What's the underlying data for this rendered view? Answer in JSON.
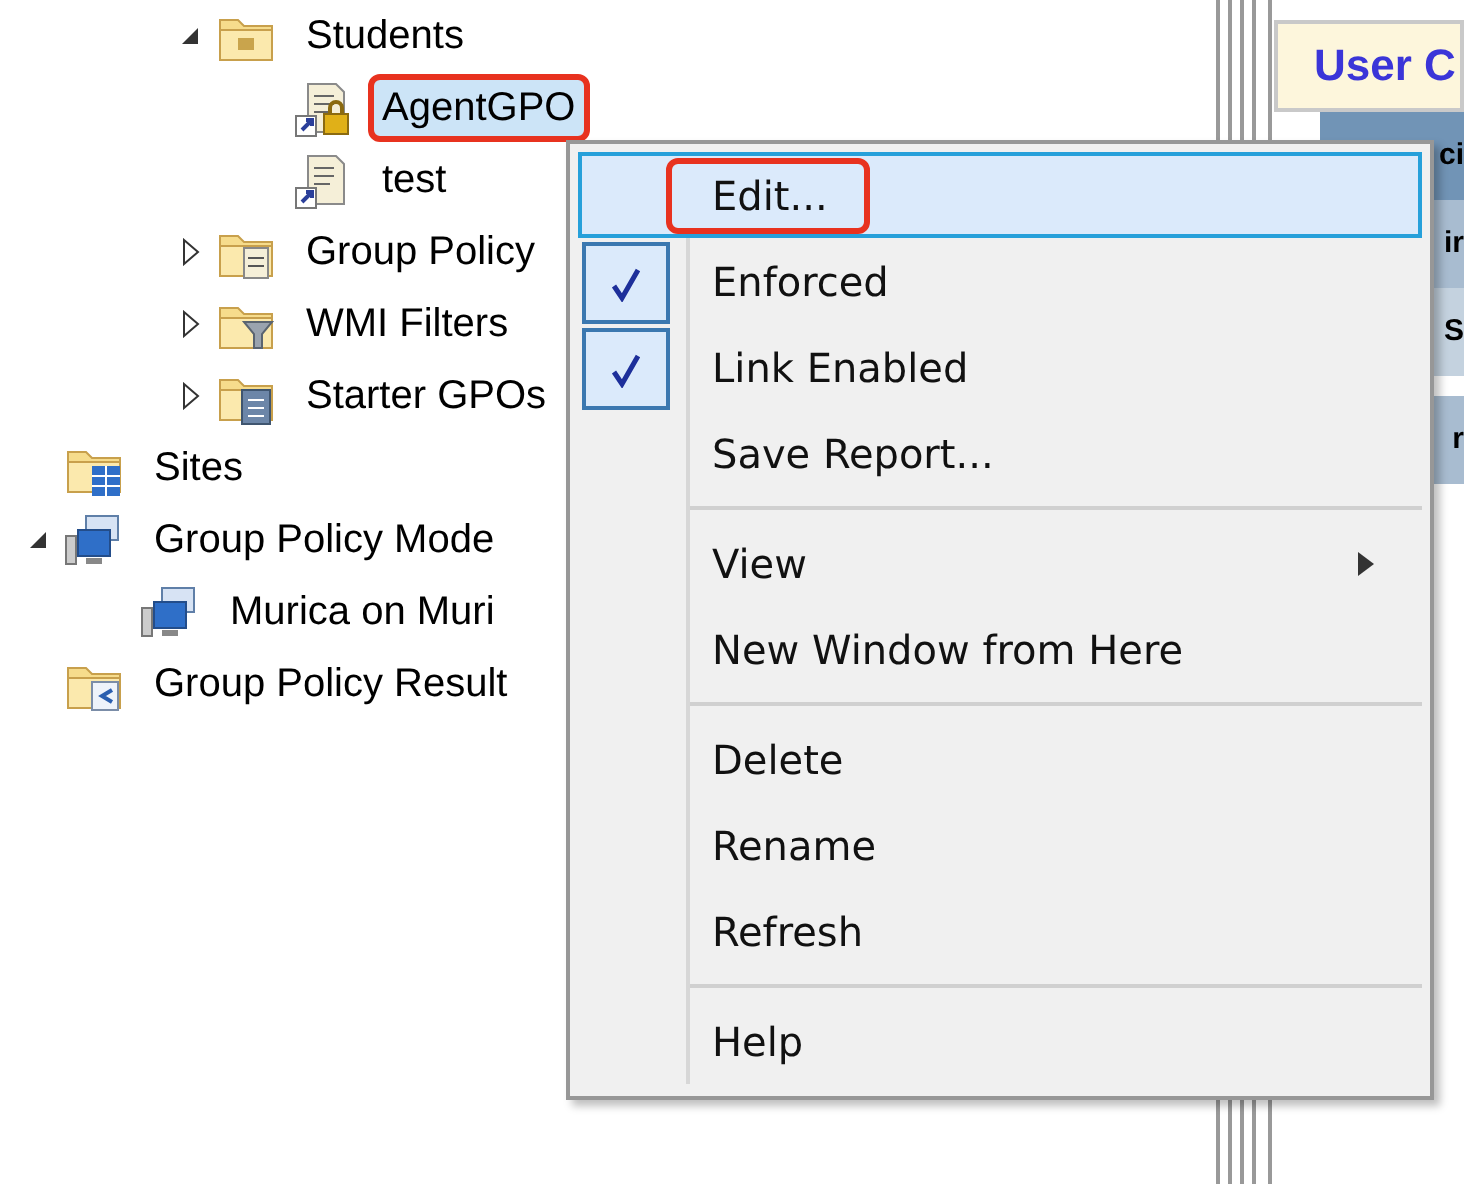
{
  "tree": {
    "branch": [
      {
        "label": "Students",
        "kind": "folder",
        "expanded": true,
        "selected": false,
        "callout": false,
        "children": [
          {
            "label": "AgentGPO",
            "kind": "gpo-locked",
            "selected": true,
            "callout": true
          },
          {
            "label": "test",
            "kind": "gpo",
            "selected": false,
            "callout": false
          }
        ]
      },
      {
        "label": "Group Policy",
        "kind": "gpo-folder",
        "expanded": false,
        "selected": false,
        "callout": false
      },
      {
        "label": "WMI Filters",
        "kind": "filters",
        "expanded": false,
        "selected": false,
        "callout": false
      },
      {
        "label": "Starter GPOs",
        "kind": "starter",
        "expanded": false,
        "selected": false,
        "callout": false
      }
    ],
    "roots": [
      {
        "label": "Sites",
        "kind": "sites",
        "selected": false,
        "callout": false
      },
      {
        "label": "Group Policy Mode",
        "kind": "modeling",
        "expanded": true,
        "selected": false,
        "callout": false,
        "children": [
          {
            "label": "Murica on Muri",
            "kind": "computer",
            "selected": false,
            "callout": false
          }
        ]
      },
      {
        "label": "Group Policy Result",
        "kind": "results",
        "selected": false,
        "callout": false
      }
    ]
  },
  "details": {
    "header": "User C",
    "rows": [
      "ci",
      "ir",
      "S",
      "r"
    ]
  },
  "context_menu": {
    "groups": [
      [
        {
          "label": "Edit...",
          "selected": true,
          "checked": false,
          "submenu": false,
          "callout": true
        },
        {
          "label": "Enforced",
          "selected": false,
          "checked": true,
          "submenu": false,
          "callout": false
        },
        {
          "label": "Link Enabled",
          "selected": false,
          "checked": true,
          "submenu": false,
          "callout": false
        },
        {
          "label": "Save Report...",
          "selected": false,
          "checked": false,
          "submenu": false,
          "callout": false
        }
      ],
      [
        {
          "label": "View",
          "selected": false,
          "checked": false,
          "submenu": true,
          "callout": false
        },
        {
          "label": "New Window from Here",
          "selected": false,
          "checked": false,
          "submenu": false,
          "callout": false
        }
      ],
      [
        {
          "label": "Delete",
          "selected": false,
          "checked": false,
          "submenu": false,
          "callout": false
        },
        {
          "label": "Rename",
          "selected": false,
          "checked": false,
          "submenu": false,
          "callout": false
        },
        {
          "label": "Refresh",
          "selected": false,
          "checked": false,
          "submenu": false,
          "callout": false
        }
      ],
      [
        {
          "label": "Help",
          "selected": false,
          "checked": false,
          "submenu": false,
          "callout": false
        }
      ]
    ]
  }
}
